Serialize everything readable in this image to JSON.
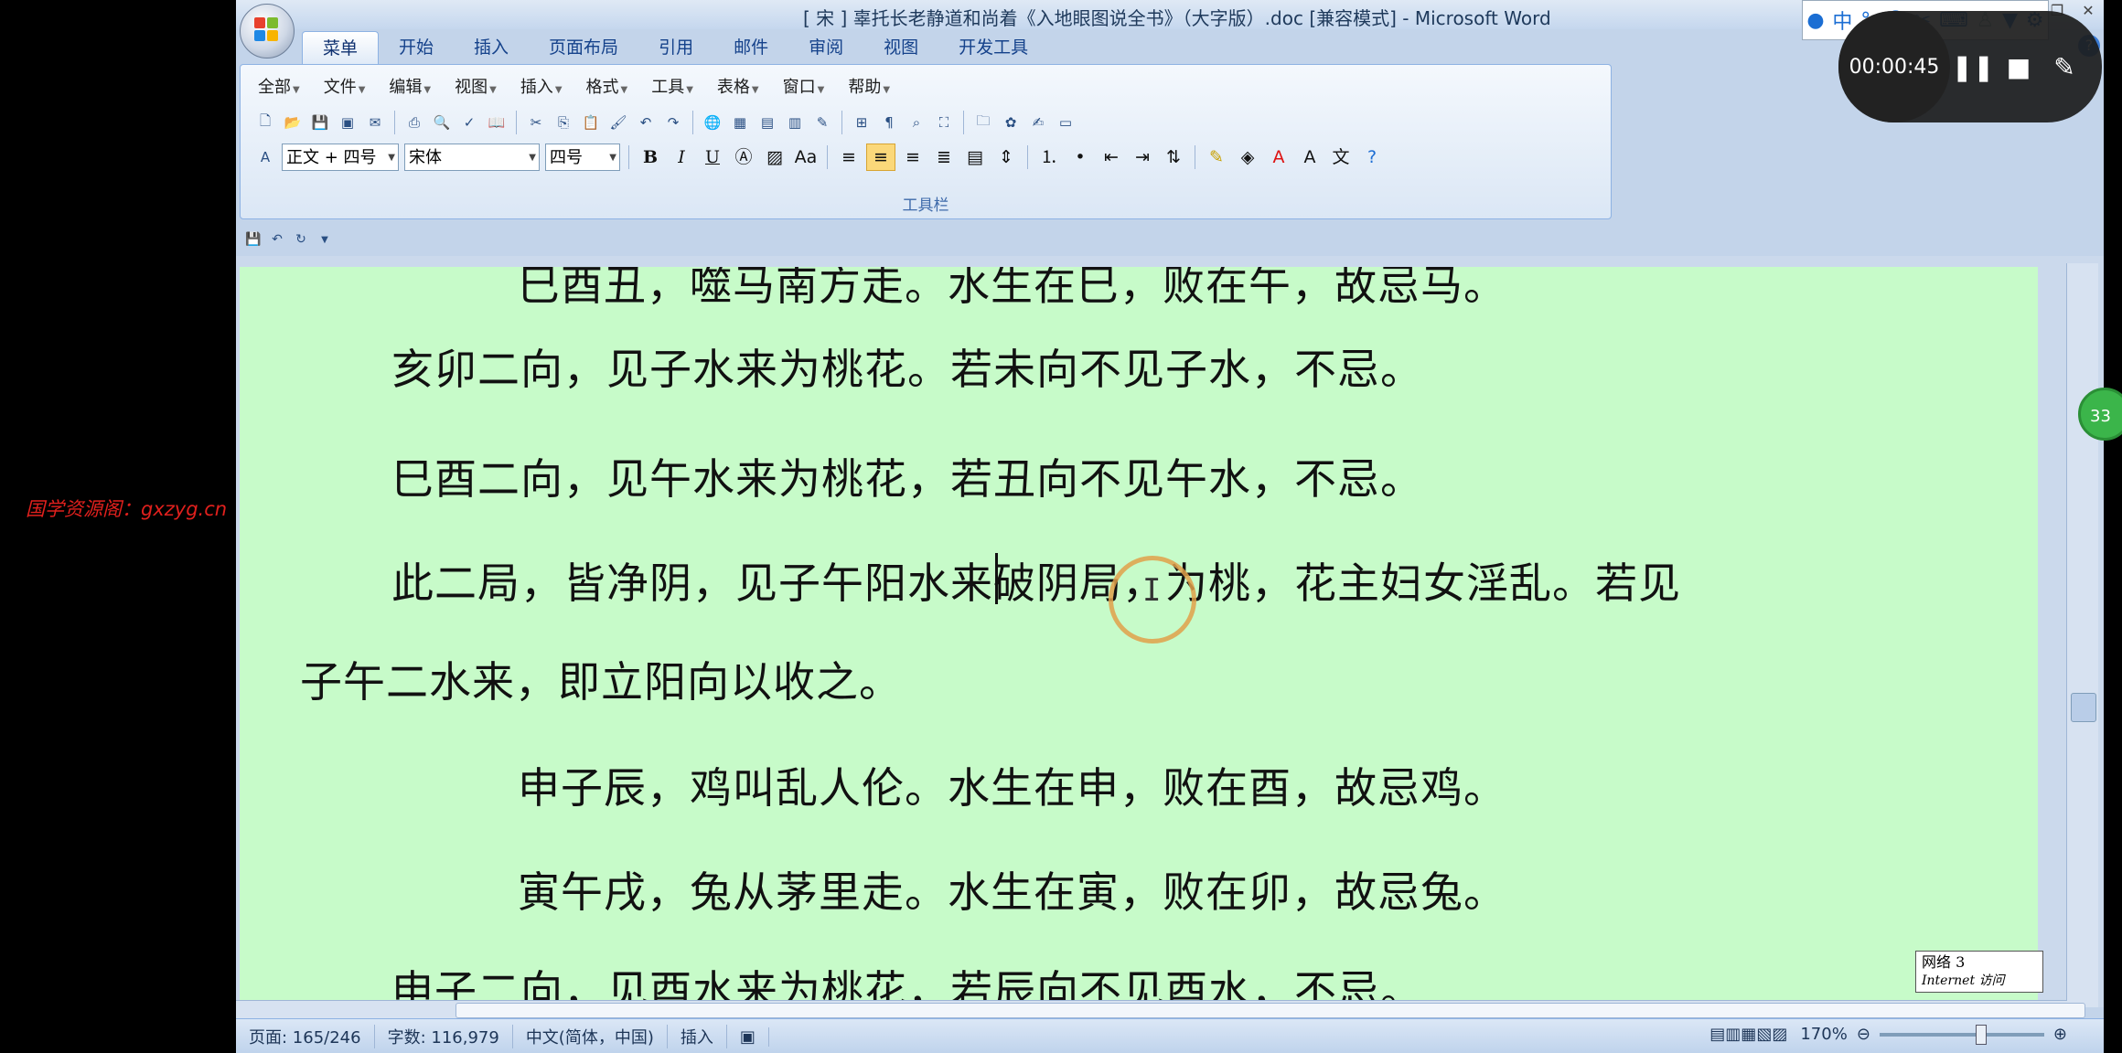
{
  "title": "[ 宋 ] 辜托长老静道和尚着《入地眼图说全书》（大字版）.doc [兼容模式] - Microsoft Word",
  "ime_bar": {
    "lang": "中",
    "icons": [
      "user-icon",
      "punct-icon",
      "emoji-icon",
      "tool-icon",
      "keyboard-icon",
      "person-icon",
      "shirt-icon",
      "gear-icon"
    ]
  },
  "ribbon_tabs": [
    "菜单",
    "开始",
    "插入",
    "页面布局",
    "引用",
    "邮件",
    "审阅",
    "视图",
    "开发工具"
  ],
  "menu_items": [
    "全部",
    "文件",
    "编辑",
    "视图",
    "插入",
    "格式",
    "工具",
    "表格",
    "窗口",
    "帮助"
  ],
  "toolbar": {
    "style_value": "正文 + 四号",
    "font_value": "宋体",
    "size_value": "四号",
    "bold": "B",
    "italic": "I",
    "underline": "U",
    "panel_label": "工具栏"
  },
  "document": {
    "lines": [
      "巳酉丑，噬马南方走。水生在巳，败在午，故忌马。",
      "亥卯二向，见子水来为桃花。若未向不见子水，不忌。",
      "巳酉二向，见午水来为桃花，若丑向不见午水，不忌。",
      "此二局，皆净阴，见子午阳水来破阴局，为桃，花主妇女淫乱。若见",
      "子午二水来，即立阳向以收之。",
      "申子辰，鸡叫乱人伦。水生在申，败在酉，故忌鸡。",
      "寅午戌，兔从茅里走。水生在寅，败在卯，故忌兔。",
      "申子二向，见酉水来为桃花，若辰向不见酉水，不忌。"
    ]
  },
  "net_box": {
    "line1": "网络  3",
    "line2": "Internet 访问"
  },
  "status": {
    "page": "页面: 165/246",
    "words": "字数: 116,979",
    "language": "中文(简体，中国)",
    "mode": "插入",
    "zoom": "170%"
  },
  "watermark": "国学资源阁：gxzyg.cn",
  "recorder": {
    "time": "00:00:45"
  },
  "badge": "33"
}
